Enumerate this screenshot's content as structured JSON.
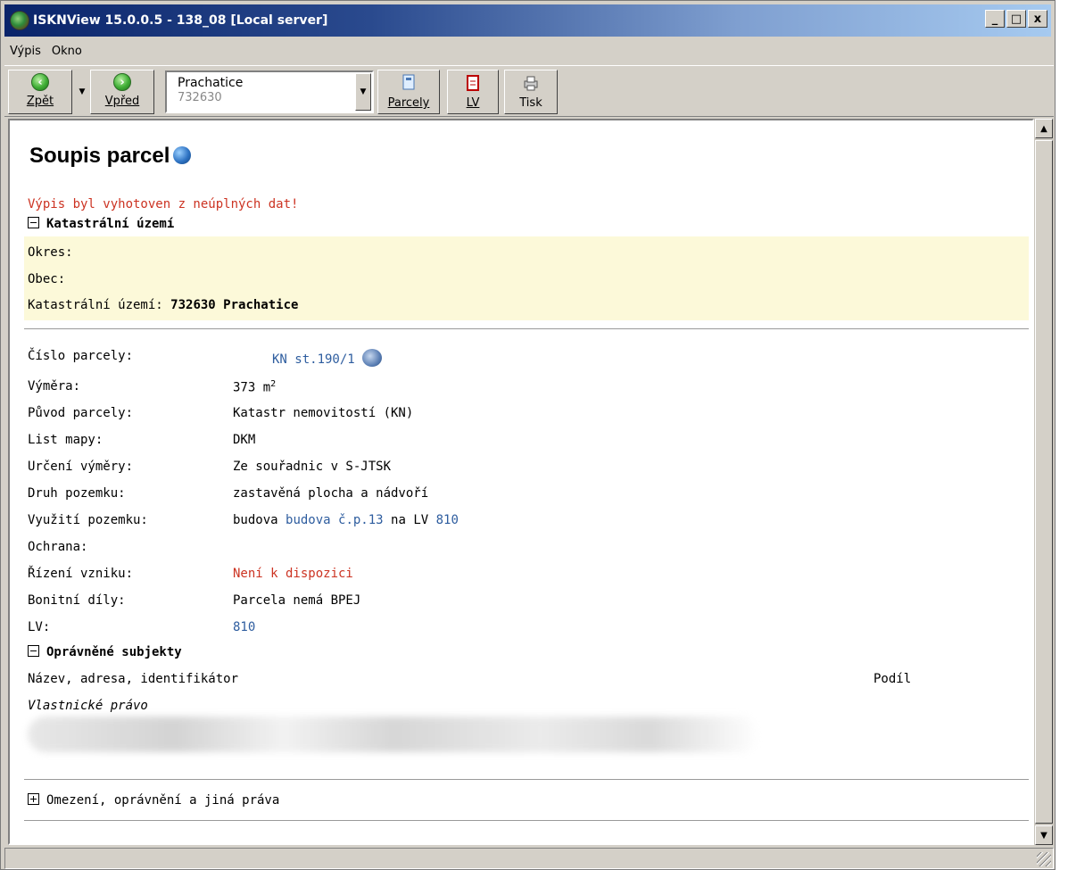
{
  "window": {
    "title": "ISKNView 15.0.0.5 - 138_08 [Local server]",
    "min": "_",
    "max": "□",
    "close": "x"
  },
  "menu": [
    "Výpis",
    "Okno"
  ],
  "toolbar": {
    "back": "Zpět",
    "forward": "Vpřed",
    "location_name": "Prachatice",
    "location_code": "732630",
    "parcels": "Parcely",
    "lv": "LV",
    "print": "Tisk"
  },
  "page": {
    "title": "Soupis parcel",
    "warning": "Výpis byl vyhotoven z neúplných dat!",
    "ku_section": "Katastrální území",
    "okres_label": "Okres:",
    "obec_label": "Obec:",
    "ku_label": "Katastrální území:",
    "ku_value": "732630 Prachatice"
  },
  "parcel": {
    "cislo_label": "Číslo parcely:",
    "cislo_value": "KN st.190/1",
    "vymera_label": "Výměra:",
    "vymera_value": "373 m",
    "vymera_sup": "2",
    "puvod_label": "Původ parcely:",
    "puvod_value": "Katastr nemovitostí (KN)",
    "list_label": "List mapy:",
    "list_value": "DKM",
    "urceni_label": "Určení výměry:",
    "urceni_value": "Ze souřadnic v S-JTSK",
    "druh_label": "Druh pozemku:",
    "druh_value": "zastavěná plocha a nádvoří",
    "vyuziti_label": "Využití pozemku:",
    "vyuziti_prefix": "budova",
    "vyuziti_link": "budova č.p.13",
    "vyuziti_mid": "na LV",
    "vyuziti_lv": "810",
    "ochrana_label": "Ochrana:",
    "rizeni_label": "Řízení vzniku:",
    "rizeni_value": "Není k dispozici",
    "bonitni_label": "Bonitní díly:",
    "bonitni_value": "Parcela nemá BPEJ",
    "lv_label": "LV:",
    "lv_value": "810"
  },
  "subjects": {
    "section": "Oprávněné subjekty",
    "col_name": "Název, adresa, identifikátor",
    "col_share": "Podíl",
    "right_type": "Vlastnické právo"
  },
  "restrictions": {
    "section": "Omezení, oprávnění a jiná práva"
  }
}
